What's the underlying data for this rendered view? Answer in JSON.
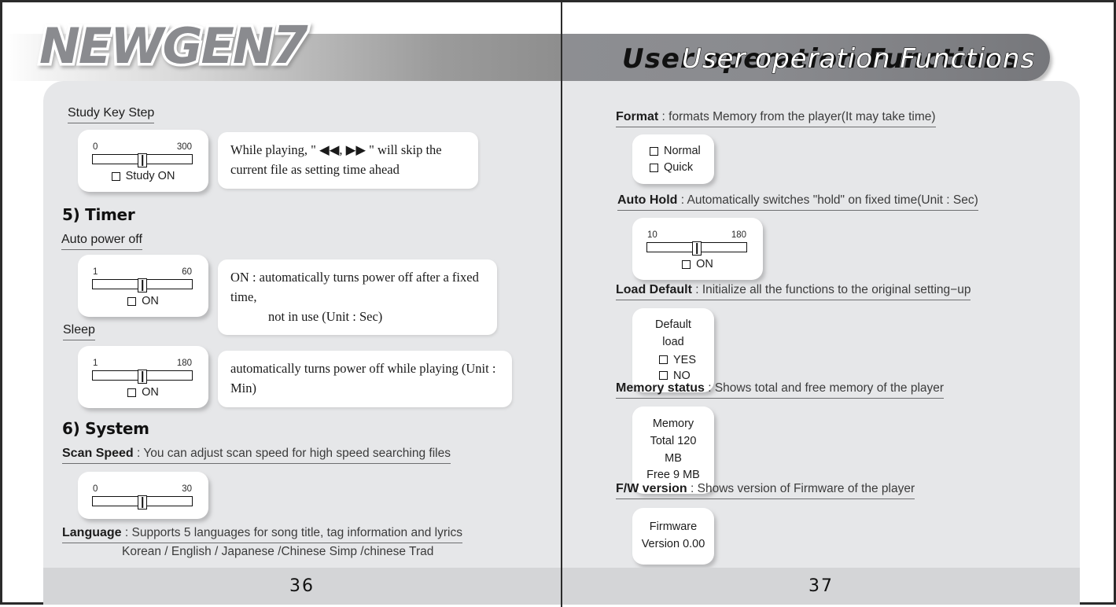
{
  "brand": {
    "logo_main": "NEWGEN",
    "logo_number": "7"
  },
  "banner": {
    "title_black": "User operation Functions",
    "title_white": "User operation Functions"
  },
  "left_page": {
    "page_number": "36",
    "study": {
      "heading": "Study Key Step",
      "slider": {
        "min": "0",
        "max": "300"
      },
      "checkbox_label": "Study ON",
      "callout": "While playing, \" ◀◀, ▶▶ \" will skip the current file as setting time ahead"
    },
    "timer": {
      "section": "5) Timer",
      "auto_power_off": {
        "heading": "Auto power off",
        "slider": {
          "min": "1",
          "max": "60"
        },
        "checkbox_label": "ON",
        "callout_line1": "ON : automatically turns power off after a fixed time,",
        "callout_line2": "not in use  (Unit : Sec)"
      },
      "sleep": {
        "heading": "Sleep",
        "slider": {
          "min": "1",
          "max": "180"
        },
        "checkbox_label": "ON",
        "callout": "automatically turns power off while playing (Unit : Min)"
      }
    },
    "system": {
      "section": "6) System",
      "scan_speed": {
        "label": "Scan Speed",
        "separator": " : ",
        "desc": "You can adjust scan speed for high speed searching files",
        "slider": {
          "min": "0",
          "max": "30"
        }
      },
      "language": {
        "label": "Language",
        "separator": " : ",
        "desc": "Supports 5 languages for song title, tag information and lyrics",
        "list": "Korean / English / Japanese /Chinese Simp /chinese Trad"
      }
    }
  },
  "right_page": {
    "page_number": "37",
    "format": {
      "label": "Format",
      "separator": " : ",
      "desc": "formats Memory from the player(It may take time)",
      "option1": "Normal",
      "option2": "Quick"
    },
    "auto_hold": {
      "label": "Auto Hold",
      "separator": " : ",
      "desc": "Automatically switches \"hold\" on fixed time(Unit : Sec)",
      "slider": {
        "min": "10",
        "max": "180"
      },
      "checkbox_label": "ON"
    },
    "load_default": {
      "label": "Load Default",
      "separator": " : ",
      "desc": "Initialize all the functions to the original setting−up",
      "card_title": "Default load",
      "option1": "YES",
      "option2": "NO"
    },
    "memory_status": {
      "label": "Memory status",
      "separator": " : ",
      "desc": "Shows total and free memory of the player",
      "card_title": "Memory",
      "total": "Total 120 MB",
      "free": "Free 9  MB"
    },
    "fw_version": {
      "label": "F/W version",
      "separator": " : ",
      "desc": "Shows version of Firmware of the player",
      "card_title": "Firmware",
      "version": "Version 0.00"
    }
  }
}
